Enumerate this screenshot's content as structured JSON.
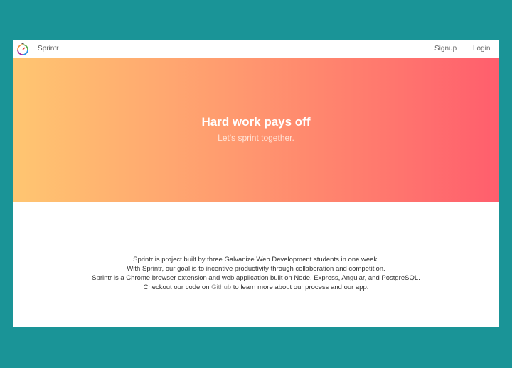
{
  "nav": {
    "brand": "Sprintr",
    "signup_label": "Signup",
    "login_label": "Login"
  },
  "hero": {
    "title": "Hard work pays off",
    "subtitle": "Let's sprint together.",
    "gradient_start": "#ffc671",
    "gradient_end": "#ff5e6d"
  },
  "about": {
    "line1": "Sprintr is project built by three Galvanize Web Development students in one week.",
    "line2": "With Sprintr, our goal is to incentive productivity through collaboration and competition.",
    "line3": "Sprintr is a Chrome browser extension and web application built on Node, Express, Angular, and PostgreSQL.",
    "line4_prefix": "Checkout our code on ",
    "line4_link": "Github",
    "line4_suffix": " to learn more about our process and our app."
  },
  "icons": {
    "logo": "stopwatch-icon"
  },
  "colors": {
    "page_background": "#1a9497",
    "link": "#888888"
  }
}
